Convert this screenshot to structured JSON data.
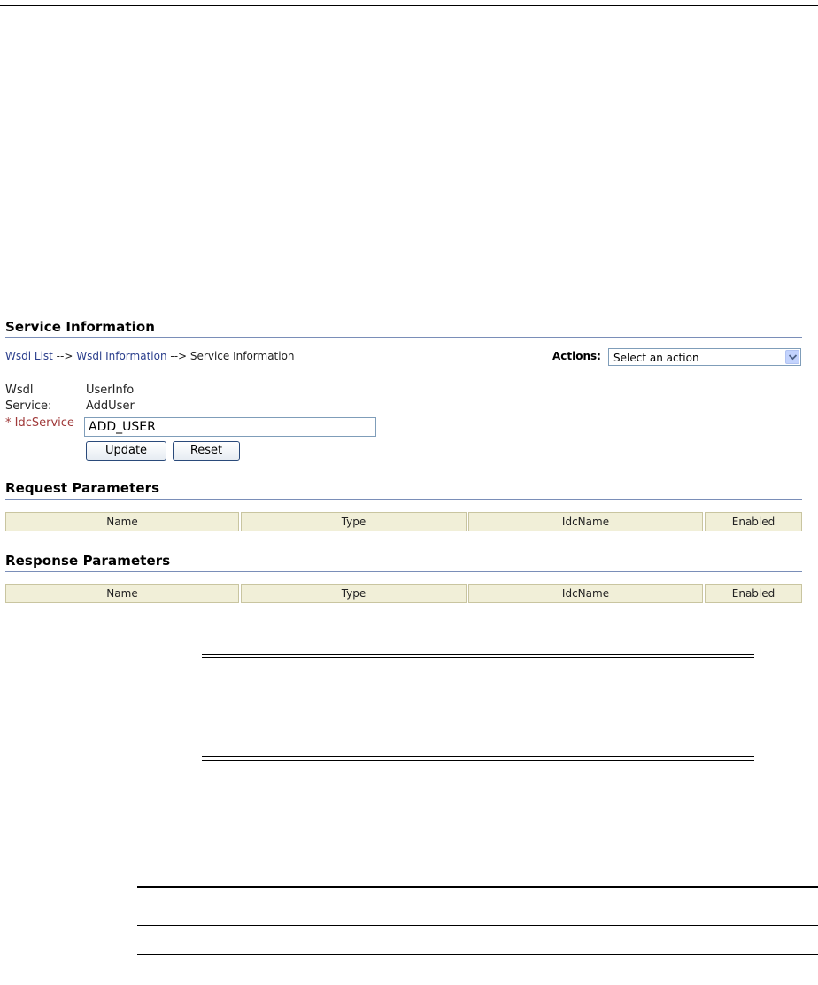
{
  "service_info": {
    "title": "Service Information",
    "breadcrumb": {
      "wsdl_list": "Wsdl List",
      "sep1": " --> ",
      "wsdl_information": "Wsdl Information",
      "sep2": " --> ",
      "current": "Service Information"
    },
    "actions": {
      "label": "Actions:",
      "selected": "Select an action"
    },
    "fields": {
      "wsdl_label": "Wsdl",
      "wsdl_value": "UserInfo",
      "service_label": "Service:",
      "service_value": "AddUser",
      "idcservice_label": "* IdcService",
      "idcservice_value": "ADD_USER"
    },
    "buttons": {
      "update": "Update",
      "reset": "Reset"
    }
  },
  "request_parameters": {
    "title": "Request Parameters",
    "columns": [
      "Name",
      "Type",
      "IdcName",
      "Enabled"
    ]
  },
  "response_parameters": {
    "title": "Response Parameters",
    "columns": [
      "Name",
      "Type",
      "IdcName",
      "Enabled"
    ]
  }
}
